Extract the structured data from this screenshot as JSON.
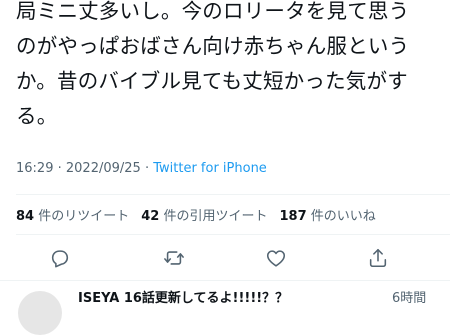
{
  "tweet": {
    "text": "局ミニ丈多いし。今のロリータを見て思う\nのがやっぱおばさん向け赤ちゃん服という\nか。昔のバイブル見ても丈短かった気がす\nる。",
    "time": "16:29",
    "separator": " · ",
    "date": "2022/09/25",
    "source": "Twitter for iPhone"
  },
  "stats": {
    "retweets": {
      "count": "84",
      "label": "件のリツイート"
    },
    "quotes": {
      "count": "42",
      "label": "件の引用ツイート"
    },
    "likes": {
      "count": "187",
      "label": "件のいいね"
    }
  },
  "actions": {
    "reply_icon": "reply-icon",
    "retweet_icon": "retweet-icon",
    "like_icon": "heart-icon",
    "share_icon": "share-icon"
  },
  "reply": {
    "name": "ISEYA 16話更新してるよ!!!!!？？",
    "time": "6時間"
  },
  "colors": {
    "text": "#0f1419",
    "secondary": "#536471",
    "link": "#1d9bf0",
    "divider": "#eff3f4"
  }
}
